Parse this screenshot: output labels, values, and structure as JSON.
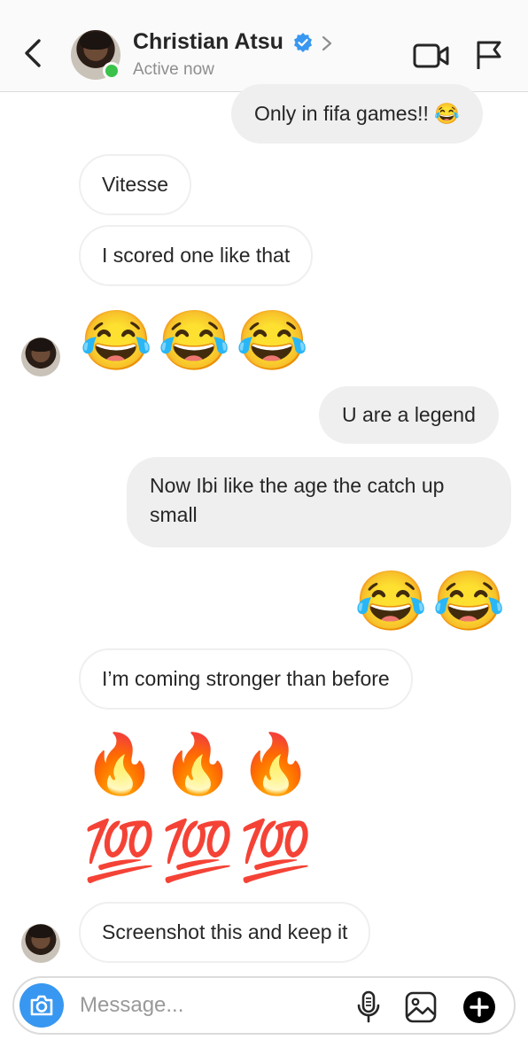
{
  "header": {
    "contact_name": "Christian Atsu",
    "status": "Active now",
    "icons": [
      "back-chevron-icon",
      "verified-badge-icon",
      "chevron-right-icon",
      "video-call-icon",
      "flag-icon"
    ]
  },
  "messages": [
    {
      "from": "me",
      "text": "Only in fifa games!! 😂"
    },
    {
      "from": "them",
      "text": "Vitesse"
    },
    {
      "from": "them",
      "text": "I scored one like that"
    },
    {
      "from": "them",
      "text": "😂😂😂"
    },
    {
      "from": "me",
      "text": "U are a legend"
    },
    {
      "from": "me",
      "text_line1": "Now Ibi like the age the catch up",
      "text_line2": "small"
    },
    {
      "from": "me",
      "text": "😂😂"
    },
    {
      "from": "them",
      "text": "I’m coming stronger than before"
    },
    {
      "from": "them",
      "text": "🔥🔥🔥"
    },
    {
      "from": "them",
      "text": "💯💯💯"
    },
    {
      "from": "them",
      "text": "Screenshot this and keep it"
    }
  ],
  "composer": {
    "placeholder": "Message...",
    "icons": [
      "camera-icon",
      "microphone-icon",
      "gallery-icon",
      "plus-icon"
    ]
  }
}
